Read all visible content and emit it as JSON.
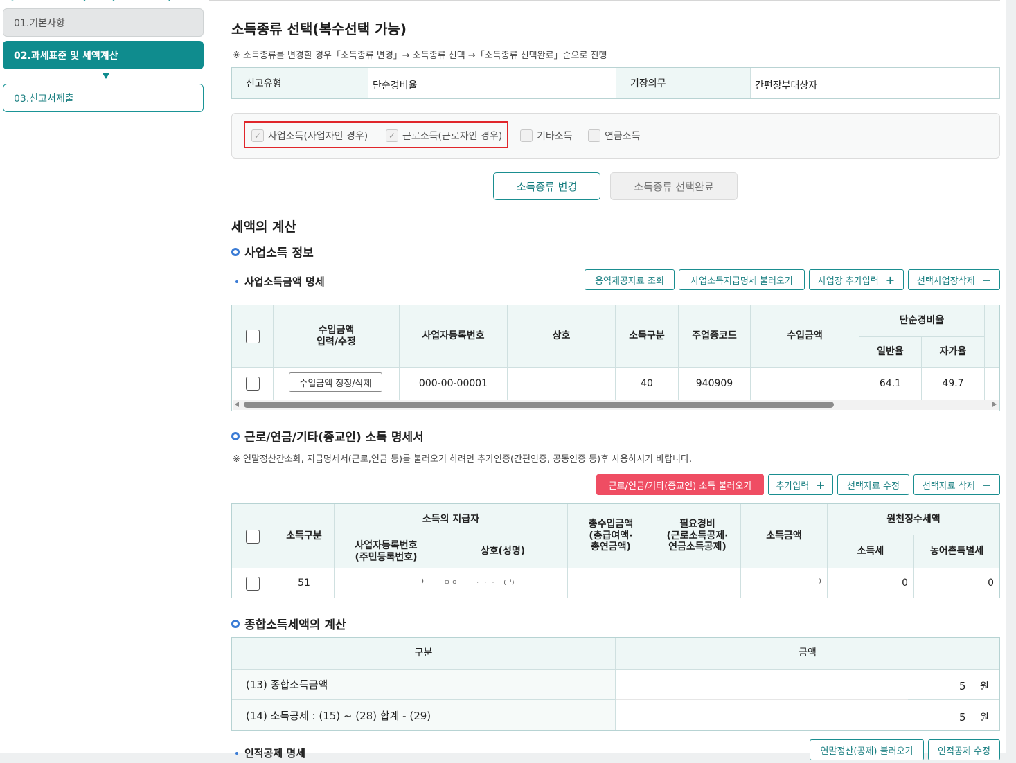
{
  "sidebar": {
    "steps": [
      {
        "label": "01.기본사항"
      },
      {
        "label": "02.과세표준 및 세액계산"
      },
      {
        "label": "03.신고서제출"
      }
    ]
  },
  "income_select": {
    "title": "소득종류 선택(복수선택 가능)",
    "note": "※ 소득종류를 변경할 경우「소득종류 변경」→ 소득종류 선택 →「소득종류 선택완료」순으로 진행",
    "report_type_label": "신고유형",
    "report_type_value": "단순경비율",
    "bookkeeping_label": "기장의무",
    "bookkeeping_value": "간편장부대상자",
    "checkboxes": [
      {
        "label": "사업소득(사업자인 경우)",
        "checked": true
      },
      {
        "label": "근로소득(근로자인 경우)",
        "checked": true
      },
      {
        "label": "기타소득",
        "checked": false
      },
      {
        "label": "연금소득",
        "checked": false
      }
    ],
    "change_button": "소득종류 변경",
    "complete_button": "소득종류 선택완료"
  },
  "tax_calc": {
    "title": "세액의 계산",
    "business": {
      "title": "사업소득 정보",
      "subtitle": "사업소득금액 명세",
      "buttons": {
        "service_lookup": "용역제공자료 조회",
        "load_statement": "사업소득지급명세 불러오기",
        "add_place": "사업장 추가입력",
        "delete_place": "선택사업장삭제"
      },
      "headers": {
        "income_edit": "수입금액\n입력/수정",
        "biz_no": "사업자등록번호",
        "company": "상호",
        "income_type": "소득구분",
        "industry_code": "주업종코드",
        "revenue": "수입금액",
        "simple_rate": "단순경비율",
        "general_rate": "일반율",
        "self_rate": "자가율"
      },
      "rows": [
        {
          "edit_button": "수입금액 정정/삭제",
          "biz_no": "000-00-00001",
          "company": "",
          "income_type": "40",
          "industry_code": "940909",
          "revenue": "",
          "general_rate": "64.1",
          "self_rate": "49.7"
        }
      ]
    },
    "labor": {
      "title": "근로/연금/기타(종교인) 소득 명세서",
      "note": "※ 연말정산간소화, 지급명세서(근로,연금 등)를 불러오기 하려면 추가인증(간편인증, 공동인증 등)후 사용하시기 바랍니다.",
      "buttons": {
        "load": "근로/연금/기타(종교인) 소득 불러오기",
        "add": "추가입력",
        "edit": "선택자료 수정",
        "delete": "선택자료 삭제"
      },
      "headers": {
        "income_type": "소득구분",
        "payer": "소득의 지급자",
        "payer_biz_no": "사업자등록번호\n(주민등록번호)",
        "payer_name": "상호(성명)",
        "total_income": "총수입금액\n(총급여액·\n총연금액)",
        "expenses": "필요경비\n(근로소득공제·\n연금소득공제)",
        "income_amount": "소득금액",
        "withholding": "원천징수세액",
        "income_tax": "소득세",
        "rural_tax": "농어촌특별세"
      },
      "rows": [
        {
          "income_type": "51",
          "payer_biz_no": "⁾",
          "payer_name": "ㅁ ㅇ ᅟ ᅮ ᅮ ᅮ ᅮ ᅳ(ᅵ)",
          "total_income": "",
          "expenses": "",
          "income_amount": "⁾",
          "income_tax": "0",
          "rural_tax": "0"
        }
      ]
    },
    "summary": {
      "title": "종합소득세액의 계산",
      "col_category": "구분",
      "col_amount": "금액",
      "rows": [
        {
          "label": "(13) 종합소득금액",
          "amount": "5",
          "unit": "원"
        },
        {
          "label": "(14) 소득공제 : (15) ~ (28) 합계 - (29)",
          "amount": "5",
          "unit": "원"
        }
      ]
    },
    "personal": {
      "subtitle": "인적공제 명세",
      "buttons": {
        "load": "연말정산(공제) 불러오기",
        "edit": "인적공제 수정"
      }
    }
  }
}
